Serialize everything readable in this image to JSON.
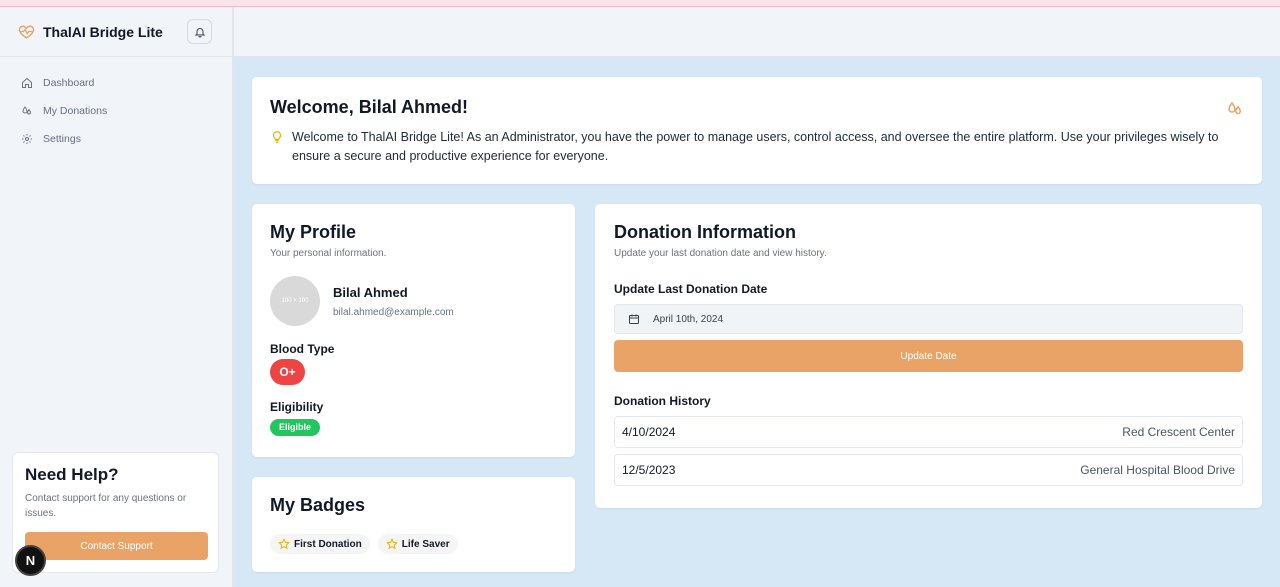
{
  "app": {
    "name": "ThalAI Bridge Lite",
    "accent": "#e9a367"
  },
  "sidebar": {
    "items": [
      {
        "label": "Dashboard",
        "icon": "home-icon"
      },
      {
        "label": "My Donations",
        "icon": "drops-icon"
      },
      {
        "label": "Settings",
        "icon": "gear-icon"
      }
    ],
    "help": {
      "title": "Need Help?",
      "text": "Contact support for any questions or issues.",
      "button": "Contact Support"
    },
    "floating_badge": "N"
  },
  "welcome": {
    "title": "Welcome, Bilal Ahmed!",
    "message": "Welcome to ThalAI Bridge Lite! As an Administrator, you have the power to manage users, control access, and oversee the entire platform. Use your privileges wisely to ensure a secure and productive experience for everyone."
  },
  "profile": {
    "title": "My Profile",
    "subtitle": "Your personal information.",
    "avatar_placeholder": "100 × 100",
    "name": "Bilal Ahmed",
    "email": "bilal.ahmed@example.com",
    "blood_type_label": "Blood Type",
    "blood_type": "O+",
    "eligibility_label": "Eligibility",
    "eligibility": "Eligible",
    "eligible_color": "#22c55e",
    "blood_color": "#ef4444"
  },
  "badges": {
    "title": "My Badges",
    "items": [
      "First Donation",
      "Life Saver"
    ]
  },
  "donation": {
    "title": "Donation Information",
    "subtitle": "Update your last donation date and view history.",
    "update_label": "Update Last Donation Date",
    "date_value": "April 10th, 2024",
    "update_button": "Update Date",
    "history_label": "Donation History",
    "history": [
      {
        "date": "4/10/2024",
        "location": "Red Crescent Center"
      },
      {
        "date": "12/5/2023",
        "location": "General Hospital Blood Drive"
      }
    ]
  }
}
